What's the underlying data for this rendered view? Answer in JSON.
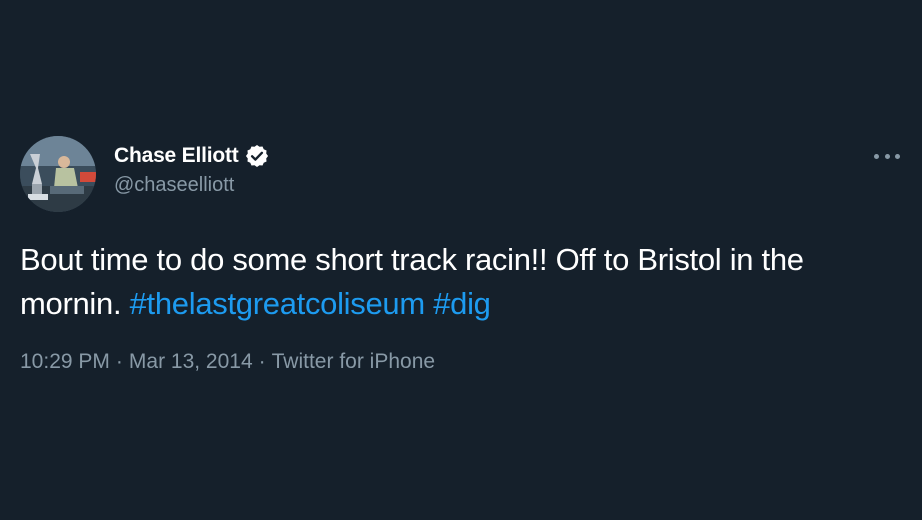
{
  "author": {
    "display_name": "Chase Elliott",
    "handle": "@chaseelliott",
    "verified": true,
    "avatar_icon": "avatar-photo"
  },
  "tweet": {
    "text_main": "Bout time to do some short track racin!! Off to Bristol in the mornin.",
    "hashtags": [
      "#thelastgreatcoliseum",
      "#dig"
    ]
  },
  "meta": {
    "time": "10:29 PM",
    "separator": "·",
    "date": "Mar 13, 2014",
    "source": "Twitter for iPhone"
  },
  "icons": {
    "verified": "verified-badge-icon",
    "more": "more-options-icon"
  },
  "colors": {
    "background": "#15202b",
    "text": "#ffffff",
    "muted": "#8899a6",
    "link": "#1d9bf0"
  }
}
